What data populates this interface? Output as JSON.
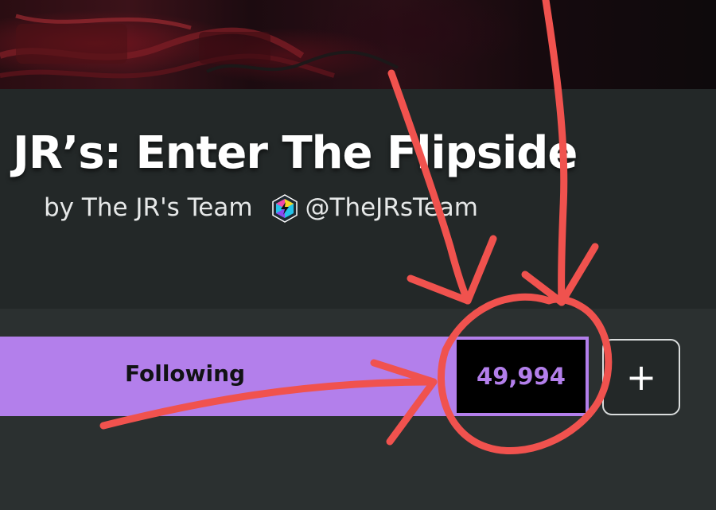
{
  "game": {
    "title": "JR’s: Enter The Flipside",
    "by_text": "by The JR's Team",
    "handle": "@TheJRsTeam"
  },
  "follow": {
    "label": "Following",
    "count": "49,994",
    "add_label": "+"
  },
  "colors": {
    "accent_purple": "#b37feb",
    "panel_dark": "#232828",
    "annotation_red": "#f0524e"
  },
  "icons": {
    "verified_badge": "verified-badge-icon",
    "add": "plus-icon"
  }
}
